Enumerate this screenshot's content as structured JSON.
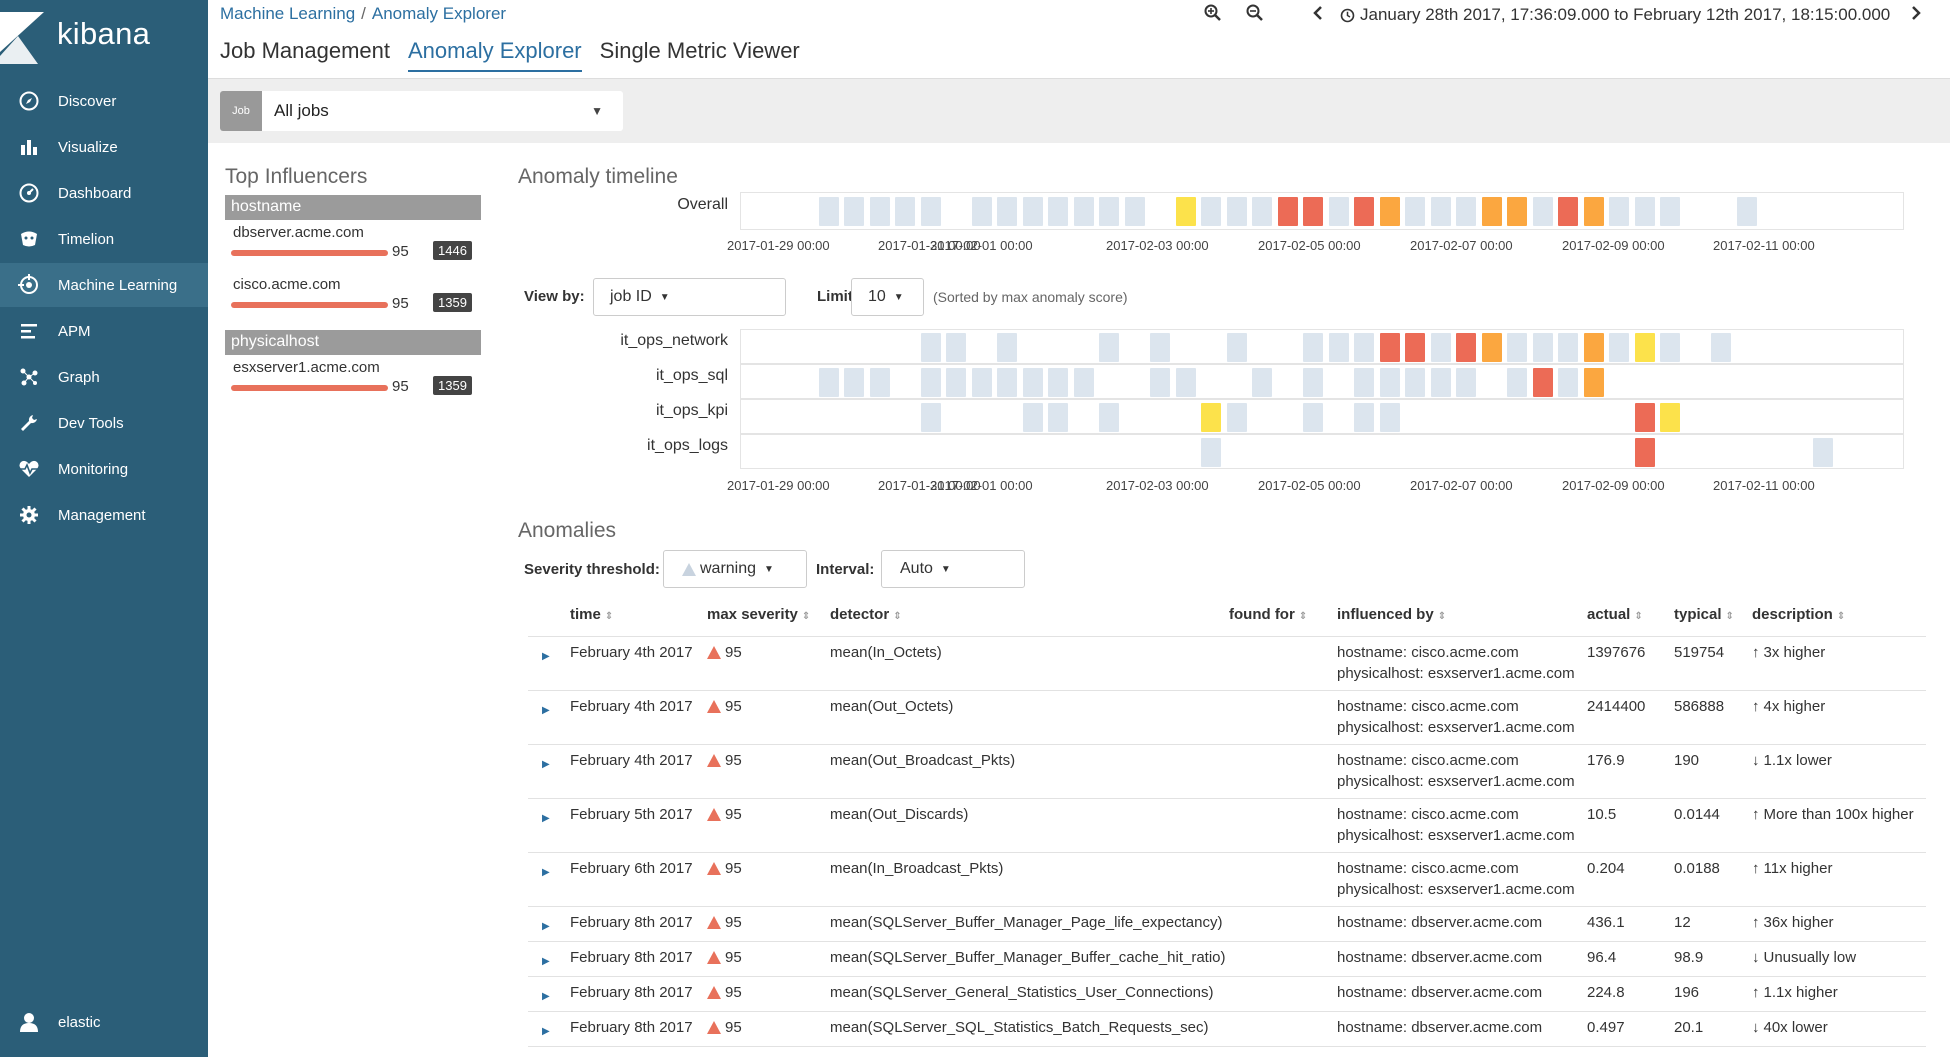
{
  "app": {
    "name": "kibana"
  },
  "nav": [
    {
      "label": "Discover",
      "icon": "compass-icon"
    },
    {
      "label": "Visualize",
      "icon": "bar-chart-icon"
    },
    {
      "label": "Dashboard",
      "icon": "dashboard-icon"
    },
    {
      "label": "Timelion",
      "icon": "timelion-icon"
    },
    {
      "label": "Machine Learning",
      "icon": "machine-learning-icon"
    },
    {
      "label": "APM",
      "icon": "apm-icon"
    },
    {
      "label": "Graph",
      "icon": "graph-icon"
    },
    {
      "label": "Dev Tools",
      "icon": "wrench-icon"
    },
    {
      "label": "Monitoring",
      "icon": "heartbeat-icon"
    },
    {
      "label": "Management",
      "icon": "gear-icon"
    }
  ],
  "user": {
    "name": "elastic"
  },
  "breadcrumb": {
    "root": "Machine Learning",
    "sep": "/",
    "current": "Anomaly Explorer"
  },
  "tabs": [
    "Job Management",
    "Anomaly Explorer",
    "Single Metric Viewer"
  ],
  "time_range": "January 28th 2017, 17:36:09.000 to February 12th 2017, 18:15:00.000",
  "job_selector": {
    "tag": "Job",
    "value": "All jobs"
  },
  "influencers": {
    "title": "Top Influencers",
    "groups": [
      {
        "field": "hostname",
        "items": [
          {
            "name": "dbserver.acme.com",
            "score": "95",
            "count": "1446"
          },
          {
            "name": "cisco.acme.com",
            "score": "95",
            "count": "1359"
          }
        ]
      },
      {
        "field": "physicalhost",
        "items": [
          {
            "name": "esxserver1.acme.com",
            "score": "95",
            "count": "1359"
          }
        ]
      }
    ]
  },
  "timeline": {
    "title": "Anomaly timeline",
    "overall_label": "Overall",
    "axis_labels": [
      "2017-01-29 00:00",
      "2017-01-31 00:00",
      "2017-02-01 00:00",
      "2017-02-03 00:00",
      "2017-02-05 00:00",
      "2017-02-07 00:00",
      "2017-02-09 00:00",
      "2017-02-11 00:00"
    ],
    "colors": {
      "low": "#dce5ee",
      "low2": "#c8d3df",
      "yellow": "#fce24b",
      "orange": "#fba740",
      "red": "#ec6b56"
    },
    "overall": "...lllll.lllllll.ylllrrlrollloolrolll..l.....",
    "lanes": [
      {
        "name": "it_ops_network",
        "cells": ".......ll.l...l.l..l..lllrrlrolllolyl.l......"
      },
      {
        "name": "it_ops_sql",
        "cells": "...lll.lllllll..ll..l.l.lllll.lrlo.........."
      },
      {
        "name": "it_ops_kpi",
        "cells": ".......l...ll.l...yl..l.ll.........ry........"
      },
      {
        "name": "it_ops_logs",
        "cells": "..................l................r......l.."
      }
    ]
  },
  "view_by": {
    "label": "View by:",
    "value": "job ID",
    "limit_label": "Limit:",
    "limit_value": "10",
    "note": "(Sorted by max anomaly score)"
  },
  "anomalies": {
    "title": "Anomalies",
    "severity_label": "Severity threshold:",
    "severity_value": "warning",
    "interval_label": "Interval:",
    "interval_value": "Auto",
    "columns": [
      "time",
      "max severity",
      "detector",
      "found for",
      "influenced by",
      "actual",
      "typical",
      "description"
    ],
    "rows": [
      {
        "time": "February 4th 2017",
        "sev": "95",
        "detector": "mean(In_Octets)",
        "infl1": "hostname: cisco.acme.com",
        "infl2": "physicalhost: esxserver1.acme.com",
        "actual": "1397676",
        "typical": "519754",
        "dir": "up",
        "desc": "3x higher"
      },
      {
        "time": "February 4th 2017",
        "sev": "95",
        "detector": "mean(Out_Octets)",
        "infl1": "hostname: cisco.acme.com",
        "infl2": "physicalhost: esxserver1.acme.com",
        "actual": "2414400",
        "typical": "586888",
        "dir": "up",
        "desc": "4x higher"
      },
      {
        "time": "February 4th 2017",
        "sev": "95",
        "detector": "mean(Out_Broadcast_Pkts)",
        "infl1": "hostname: cisco.acme.com",
        "infl2": "physicalhost: esxserver1.acme.com",
        "actual": "176.9",
        "typical": "190",
        "dir": "down",
        "desc": "1.1x lower"
      },
      {
        "time": "February 5th 2017",
        "sev": "95",
        "detector": "mean(Out_Discards)",
        "infl1": "hostname: cisco.acme.com",
        "infl2": "physicalhost: esxserver1.acme.com",
        "actual": "10.5",
        "typical": "0.0144",
        "dir": "up",
        "desc": "More than 100x higher"
      },
      {
        "time": "February 6th 2017",
        "sev": "95",
        "detector": "mean(In_Broadcast_Pkts)",
        "infl1": "hostname: cisco.acme.com",
        "infl2": "physicalhost: esxserver1.acme.com",
        "actual": "0.204",
        "typical": "0.0188",
        "dir": "up",
        "desc": "11x higher"
      },
      {
        "time": "February 8th 2017",
        "sev": "95",
        "detector": "mean(SQLServer_Buffer_Manager_Page_life_expectancy)",
        "infl1": "hostname: dbserver.acme.com",
        "infl2": "",
        "actual": "436.1",
        "typical": "12",
        "dir": "up",
        "desc": "36x higher"
      },
      {
        "time": "February 8th 2017",
        "sev": "95",
        "detector": "mean(SQLServer_Buffer_Manager_Buffer_cache_hit_ratio)",
        "infl1": "hostname: dbserver.acme.com",
        "infl2": "",
        "actual": "96.4",
        "typical": "98.9",
        "dir": "down",
        "desc": "Unusually low"
      },
      {
        "time": "February 8th 2017",
        "sev": "95",
        "detector": "mean(SQLServer_General_Statistics_User_Connections)",
        "infl1": "hostname: dbserver.acme.com",
        "infl2": "",
        "actual": "224.8",
        "typical": "196",
        "dir": "up",
        "desc": "1.1x higher"
      },
      {
        "time": "February 8th 2017",
        "sev": "95",
        "detector": "mean(SQLServer_SQL_Statistics_Batch_Requests_sec)",
        "infl1": "hostname: dbserver.acme.com",
        "infl2": "",
        "actual": "0.497",
        "typical": "20.1",
        "dir": "down",
        "desc": "40x lower"
      }
    ]
  }
}
